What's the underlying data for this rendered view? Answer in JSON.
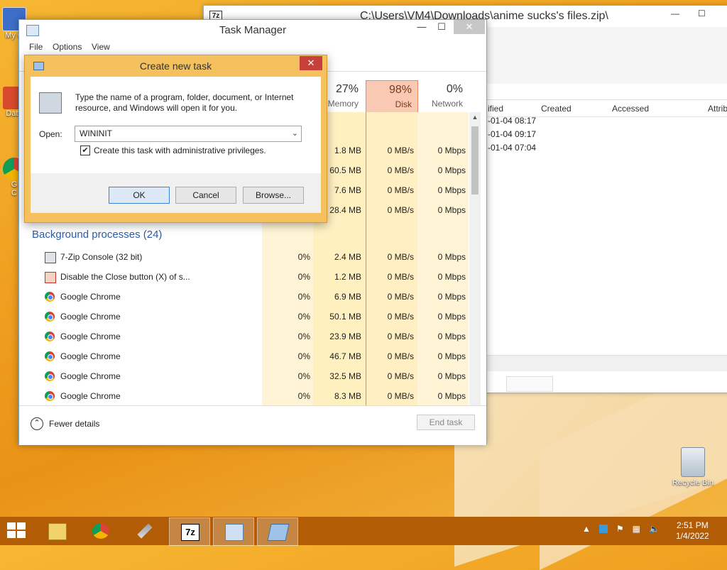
{
  "desktop": {
    "icons": [
      {
        "label": "My C",
        "name": "my-computer"
      },
      {
        "label": "Data",
        "name": "data"
      },
      {
        "label": "G\nC",
        "name": "google-chrome-shortcut"
      }
    ],
    "recycle_bin_label": "Recycle Bin"
  },
  "zip_window": {
    "title": "C:\\Users\\VM4\\Downloads\\anime sucks's files.zip\\",
    "columns": [
      "ified",
      "Created",
      "Accessed",
      "Attrib"
    ],
    "rows": [
      "-01-04 08:17",
      "-01-04 09:17",
      "-01-04 07:04"
    ]
  },
  "task_manager": {
    "title": "Task Manager",
    "menu": [
      "File",
      "Options",
      "View"
    ],
    "headers": {
      "memory": {
        "pct": "27%",
        "label": "Memory"
      },
      "disk": {
        "pct": "98%",
        "label": "Disk"
      },
      "network": {
        "pct": "0%",
        "label": "Network"
      }
    },
    "top_rows": [
      {
        "mem": "1.8 MB",
        "disk": "0 MB/s",
        "net": "0 Mbps"
      },
      {
        "mem": "60.5 MB",
        "disk": "0 MB/s",
        "net": "0 Mbps"
      },
      {
        "mem": "7.6 MB",
        "disk": "0 MB/s",
        "net": "0 Mbps"
      },
      {
        "mem": "28.4 MB",
        "disk": "0 MB/s",
        "net": "0 Mbps"
      }
    ],
    "group_title": "Background processes (24)",
    "processes": [
      {
        "name": "7-Zip Console (32 bit)",
        "icon": "console-icon",
        "cpu": "0%",
        "mem": "2.4 MB",
        "disk": "0 MB/s",
        "net": "0 Mbps"
      },
      {
        "name": "Disable the Close button (X) of s...",
        "icon": "disable-close-icon",
        "cpu": "0%",
        "mem": "1.2 MB",
        "disk": "0 MB/s",
        "net": "0 Mbps"
      },
      {
        "name": "Google Chrome",
        "icon": "chrome-icon",
        "cpu": "0%",
        "mem": "6.9 MB",
        "disk": "0 MB/s",
        "net": "0 Mbps"
      },
      {
        "name": "Google Chrome",
        "icon": "chrome-icon",
        "cpu": "0%",
        "mem": "50.1 MB",
        "disk": "0 MB/s",
        "net": "0 Mbps"
      },
      {
        "name": "Google Chrome",
        "icon": "chrome-icon",
        "cpu": "0%",
        "mem": "23.9 MB",
        "disk": "0 MB/s",
        "net": "0 Mbps"
      },
      {
        "name": "Google Chrome",
        "icon": "chrome-icon",
        "cpu": "0%",
        "mem": "46.7 MB",
        "disk": "0 MB/s",
        "net": "0 Mbps"
      },
      {
        "name": "Google Chrome",
        "icon": "chrome-icon",
        "cpu": "0%",
        "mem": "32.5 MB",
        "disk": "0 MB/s",
        "net": "0 Mbps"
      },
      {
        "name": "Google Chrome",
        "icon": "chrome-icon",
        "cpu": "0%",
        "mem": "8.3 MB",
        "disk": "0 MB/s",
        "net": "0 Mbps"
      }
    ],
    "fewer_details": "Fewer details",
    "end_task": "End task"
  },
  "dialog": {
    "title": "Create new task",
    "description": "Type the name of a program, folder, document, or Internet resource, and Windows will open it for you.",
    "open_label": "Open:",
    "open_value": "WININIT",
    "admin_checkbox_label": "Create this task with administrative privileges.",
    "admin_checked": true,
    "ok": "OK",
    "cancel": "Cancel",
    "browse": "Browse...",
    "close_glyph": "✕"
  },
  "taskbar": {
    "apps": [
      "file-explorer",
      "google-chrome",
      "tool-app",
      "7-zip",
      "task-manager",
      "create-task-dialog"
    ],
    "time": "2:51 PM",
    "date": "1/4/2022"
  },
  "colors": {
    "accent": "#f5c15f",
    "disk_highlight": "#f9c9b3",
    "taskbar": "#b25d05"
  }
}
